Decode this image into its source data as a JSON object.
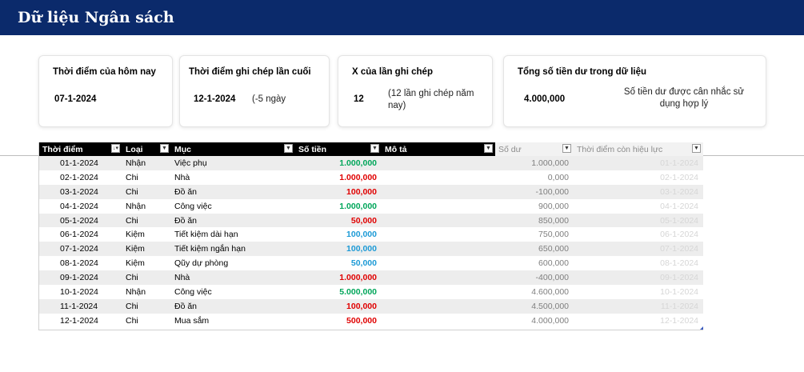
{
  "header": {
    "title": "Dữ liệu Ngân sách"
  },
  "cards": {
    "today": {
      "label": "Thời điểm của hôm nay",
      "value": "07-1-2024"
    },
    "last": {
      "label": "Thời điểm ghi chép lần cuối",
      "value": "12-1-2024",
      "note": "(-5 ngày"
    },
    "count": {
      "label": "X của lần ghi chép",
      "value": "12",
      "note": "(12 lần ghi chép năm nay)"
    },
    "total": {
      "label": "Tổng số tiền dư trong dữ liệu",
      "value": "4.000,000",
      "note": "Số tiền dư được cân nhắc sử dụng hợp lý"
    }
  },
  "table": {
    "headers": {
      "date": "Thời điểm",
      "type": "Loại",
      "item": "Mục",
      "amount": "Số tiền",
      "desc": "Mô tả",
      "balance": "Số dư",
      "valid": "Thời điểm còn hiệu lực"
    },
    "rows": [
      {
        "date": "01-1-2024",
        "type": "Nhận",
        "item": "Việc phụ",
        "amount": "1.000,000",
        "balance": "1.000,000",
        "valid": "01-1-2024"
      },
      {
        "date": "02-1-2024",
        "type": "Chi",
        "item": "Nhà",
        "amount": "1.000,000",
        "balance": "0,000",
        "valid": "02-1-2024"
      },
      {
        "date": "03-1-2024",
        "type": "Chi",
        "item": "Đồ ăn",
        "amount": "100,000",
        "balance": "-100,000",
        "valid": "03-1-2024"
      },
      {
        "date": "04-1-2024",
        "type": "Nhận",
        "item": "Công việc",
        "amount": "1.000,000",
        "balance": "900,000",
        "valid": "04-1-2024"
      },
      {
        "date": "05-1-2024",
        "type": "Chi",
        "item": "Đồ ăn",
        "amount": "50,000",
        "balance": "850,000",
        "valid": "05-1-2024"
      },
      {
        "date": "06-1-2024",
        "type": "Kiệm",
        "item": "Tiết kiệm dài hạn",
        "amount": "100,000",
        "balance": "750,000",
        "valid": "06-1-2024"
      },
      {
        "date": "07-1-2024",
        "type": "Kiệm",
        "item": "Tiết kiệm ngắn hạn",
        "amount": "100,000",
        "balance": "650,000",
        "valid": "07-1-2024"
      },
      {
        "date": "08-1-2024",
        "type": "Kiệm",
        "item": "Qũy dự phòng",
        "amount": "50,000",
        "balance": "600,000",
        "valid": "08-1-2024"
      },
      {
        "date": "09-1-2024",
        "type": "Chi",
        "item": "Nhà",
        "amount": "1.000,000",
        "balance": "-400,000",
        "valid": "09-1-2024"
      },
      {
        "date": "10-1-2024",
        "type": "Nhận",
        "item": "Công việc",
        "amount": "5.000,000",
        "balance": "4.600,000",
        "valid": "10-1-2024"
      },
      {
        "date": "11-1-2024",
        "type": "Chi",
        "item": "Đồ ăn",
        "amount": "100,000",
        "balance": "4.500,000",
        "valid": "11-1-2024"
      },
      {
        "date": "12-1-2024",
        "type": "Chi",
        "item": "Mua sắm",
        "amount": "500,000",
        "balance": "4.000,000",
        "valid": "12-1-2024"
      }
    ]
  },
  "colors": {
    "header_bg": "#0b2a6b",
    "Nhận": "#00a65a",
    "Chi": "#e00000",
    "Kiệm": "#1c9ad6"
  },
  "icons": {
    "filter": "filter-dropdown-icon",
    "sort_filter": "sort-filter-icon"
  }
}
